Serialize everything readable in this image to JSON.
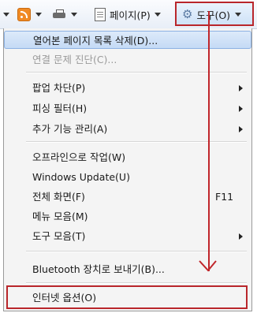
{
  "toolbar": {
    "page_label": "페이지(P)",
    "tools_label": "도구(O)"
  },
  "menu": {
    "items": [
      {
        "label": "열어본 페이지 목록 삭제(D)..."
      },
      {
        "label": "연결 문제 진단(C)..."
      },
      {
        "label": "팝업 차단(P)"
      },
      {
        "label": "피싱 필터(H)"
      },
      {
        "label": "추가 기능 관리(A)"
      },
      {
        "label": "오프라인으로 작업(W)"
      },
      {
        "label": "Windows Update(U)"
      },
      {
        "label": "전체 화면(F)",
        "accel": "F11"
      },
      {
        "label": "메뉴 모음(M)"
      },
      {
        "label": "도구 모음(T)"
      },
      {
        "label": "Bluetooth 장치로 보내기(B)..."
      },
      {
        "label": "인터넷 옵션(O)"
      }
    ]
  },
  "colors": {
    "highlight_border": "#b9262b",
    "menu_highlight": "#c4daf5"
  },
  "icons": [
    "rss-feed-icon",
    "printer-icon",
    "page-icon",
    "gear-icon",
    "chevron-down-icon",
    "submenu-arrow-icon"
  ]
}
